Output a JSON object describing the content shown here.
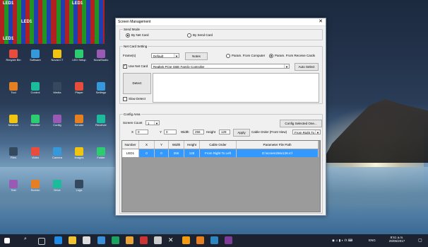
{
  "desktop": {
    "led_panels": [
      {
        "label": "LED1"
      },
      {
        "label": "LED1"
      },
      {
        "label": "LED1"
      },
      {
        "label": "LED1"
      }
    ],
    "icons": [
      "Recycle Bin",
      "Software",
      "NovaLCT",
      "LED Setup",
      "NovaStudio",
      "Tool",
      "Control",
      "Media",
      "Player",
      "Settings",
      "Network",
      "Monitor",
      "Config",
      "Sender",
      "Receiver",
      "Files",
      "Video",
      "Camera",
      "Images",
      "Folder",
      "Test",
      "Screen",
      "Drive",
      "Logs"
    ]
  },
  "window": {
    "title": "Screen Management",
    "send_mode": {
      "legend": "Send Mode",
      "by_net_card": "By Net Card",
      "by_send_card": "By Send Card",
      "selected": "by_net_card"
    },
    "net_card_setting": {
      "legend": "Net Card Setting",
      "frames_label": "Frame(s)",
      "frames_value": "Default",
      "notes_button": "Notes",
      "param_from_computer": "Param. From Computer",
      "param_from_receive_cards": "Param. From Receive Cards",
      "use_net_card_label": "Use Net Card",
      "use_net_card_checked": true,
      "net_card_value": "Realtek PCIe GBE Family Controller",
      "auto_select_button": "Auto Select",
      "detect_button": "Detect",
      "slow_detect_label": "Slow Detect"
    },
    "config_area": {
      "legend": "Config Area",
      "screen_count_label": "Screen Count",
      "screen_count_value": "1",
      "config_selected_button": "Config Selected One...",
      "x_label": "X",
      "x_value": "0",
      "y_label": "Y",
      "y_value": "0",
      "width_label": "Width",
      "width_value": "256",
      "height_label": "Height",
      "height_value": "128",
      "apply_button": "Apply",
      "cable_order_label": "Cable Order (Front View)",
      "cable_order_value": "From Right To Le"
    },
    "table": {
      "columns": [
        "Number",
        "X",
        "Y",
        "Width",
        "Height",
        "Cable Order",
        "Parameter File Path"
      ],
      "rows": [
        [
          "LED1",
          "0",
          "0",
          "256",
          "128",
          "From Right To Left",
          "D:\\screen256x128.rcf"
        ]
      ]
    }
  },
  "taskbar": {
    "tray_lang": "ENG",
    "time": "8:51 a.m.",
    "date": "29/05/2017"
  }
}
